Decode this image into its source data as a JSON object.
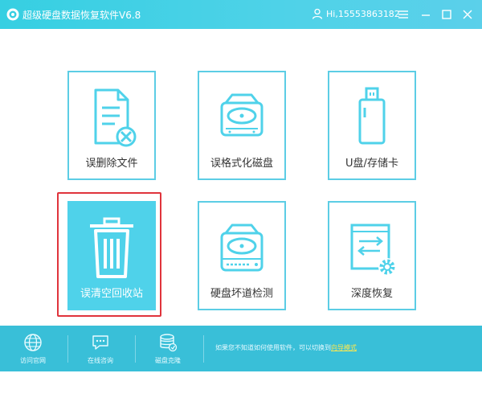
{
  "titlebar": {
    "app_title": "超级硬盘数据恢复软件V6.8",
    "user": "Hi,15553863182"
  },
  "tiles": [
    {
      "label": "误删除文件",
      "icon": "deleted-file-icon"
    },
    {
      "label": "误格式化磁盘",
      "icon": "disk-icon"
    },
    {
      "label": "U盘/存储卡",
      "icon": "usb-drive-icon"
    },
    {
      "label": "误清空回收站",
      "icon": "trash-icon",
      "selected": true
    },
    {
      "label": "硬盘坏道检测",
      "icon": "hard-drive-icon"
    },
    {
      "label": "深度恢复",
      "icon": "deep-recovery-icon"
    }
  ],
  "bottombar": {
    "items": [
      {
        "label": "访问官网",
        "icon": "globe-icon"
      },
      {
        "label": "在线咨询",
        "icon": "chat-icon"
      },
      {
        "label": "磁盘克隆",
        "icon": "database-clone-icon"
      }
    ],
    "hint": "如果您不知道如何使用软件，可以切换到",
    "link": "向导模式"
  },
  "colors": {
    "accent": "#4fd2ea",
    "titlebar": "#36cfe2",
    "bottombar": "#39bfd8",
    "selection": "#e0343c",
    "link": "#ffe84d"
  }
}
